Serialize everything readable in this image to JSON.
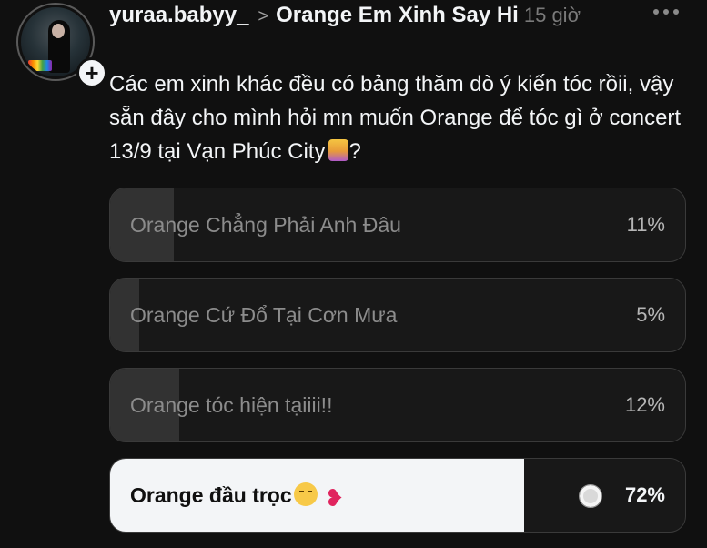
{
  "post": {
    "username": "yuraa.babyy_",
    "community": "Orange Em Xinh Say Hi",
    "time": "15 giờ",
    "text": "Các em xinh khác đều có bảng thăm dò ý kiến tóc rồii, vậy sẵn đây cho mình hỏi mn muốn Orange để tóc gì ở concert 13/9 tại Vạn Phúc City",
    "text_end": "?"
  },
  "poll": {
    "options": [
      {
        "label": "Orange Chẳng Phải Anh Đâu",
        "percent_label": "11%",
        "percent": 11,
        "selected": false
      },
      {
        "label": "Orange Cứ Đổ Tại Cơn Mưa",
        "percent_label": "5%",
        "percent": 5,
        "selected": false
      },
      {
        "label": "Orange tóc hiện tạiiii!!",
        "percent_label": "12%",
        "percent": 12,
        "selected": false
      },
      {
        "label": "Orange đầu trọc",
        "percent_label": "72%",
        "percent": 72,
        "selected": true
      }
    ]
  },
  "icons": {
    "more": "more-horizontal-icon",
    "chevron": "chevron-right-icon",
    "follow": "plus-icon",
    "selected": "check-circle-icon",
    "emoji_dancer": "dancing-woman-emoji",
    "emoji_sad": "pensive-face-emoji",
    "emoji_heart": "broken-heart-emoji"
  },
  "colors": {
    "background": "#101010",
    "text": "#f3f5f7",
    "muted": "#7a7a7a",
    "poll_fill": "#323232",
    "poll_selected_fill": "#f3f5f7",
    "broken_heart": "#e0245e"
  }
}
